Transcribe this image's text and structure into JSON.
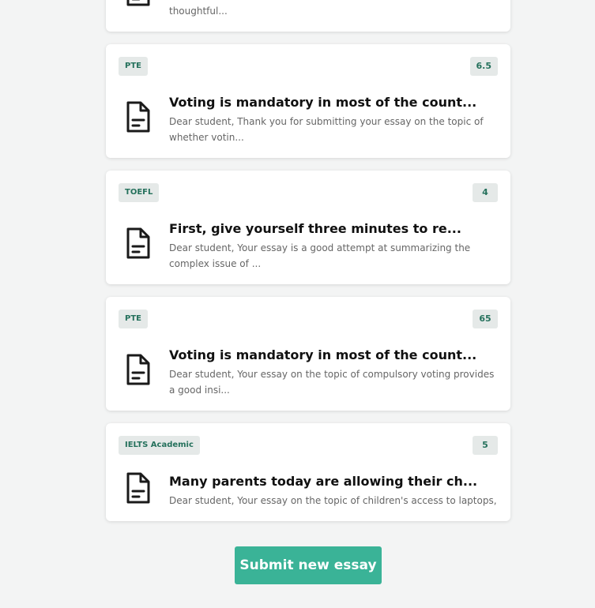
{
  "essays": [
    {
      "badge": "",
      "score": "",
      "title": "",
      "excerpt": "thoughtful..."
    },
    {
      "badge": "PTE",
      "score": "6.5",
      "title": "Voting is mandatory in most of the count...",
      "excerpt": "Dear student, Thank you for submitting your essay on the topic of whether votin..."
    },
    {
      "badge": "TOEFL",
      "score": "4",
      "title": "First, give yourself three minutes to re...",
      "excerpt": "Dear student, Your essay is a good attempt at summarizing the complex issue of ..."
    },
    {
      "badge": "PTE",
      "score": "65",
      "title": "Voting is mandatory in most of the count...",
      "excerpt": "Dear student, Your essay on the topic of compulsory voting provides a good insi..."
    },
    {
      "badge": "IELTS Academic",
      "score": "5",
      "title": "Many parents today are allowing their ch...",
      "excerpt": "Dear student, Your essay on the topic of children's access to laptops, tablets,..."
    }
  ],
  "submit_label": "Submit new essay",
  "colors": {
    "accent": "#3ab397",
    "badge_bg": "#e5e9e8",
    "badge_text": "#25715c"
  },
  "icons": {
    "document": "document-icon"
  }
}
